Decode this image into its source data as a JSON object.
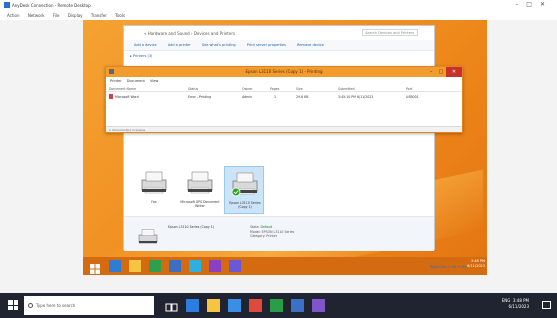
{
  "viewer": {
    "title": "AnyDesk Connection - Remote Desktop",
    "menu": [
      "Action",
      "Network",
      "File",
      "Display",
      "Transfer",
      "Tools"
    ],
    "window_controls": [
      "–",
      "□",
      "✕"
    ]
  },
  "explorer": {
    "breadcrumbs": "« Hardware and Sound › Devices and Printers",
    "search_placeholder": "Search Devices and Printers",
    "commands": [
      "Add a device",
      "Add a printer",
      "See what's printing",
      "Print server properties",
      "Remove device"
    ],
    "section_link": "▸ Printers (3)",
    "printers": [
      {
        "label": "Fax"
      },
      {
        "label": "Microsoft XPS Document Writer"
      },
      {
        "label": "Epson L3110 Series (Copy 1)"
      }
    ],
    "details": {
      "name": "Epson L3110 Series (Copy 1)",
      "state_label": "State:",
      "state_value": "Default",
      "model_label": "Model:",
      "model_value": "EPSON L3110 Series",
      "category_label": "Category:",
      "category_value": "Printer"
    }
  },
  "queue": {
    "title": "Epson L3110 Series (Copy 1) - Printing",
    "menu": [
      "Printer",
      "Document",
      "View"
    ],
    "columns": [
      "Document Name",
      "Status",
      "Owner",
      "Pages",
      "Size",
      "Submitted",
      "Port"
    ],
    "rows": [
      {
        "name": "Microsoft Word",
        "status": "Error - Printing",
        "owner": "Admin",
        "pages": "1",
        "size": "29.6 KB",
        "submitted": "3:45:10 PM 6/11/2023",
        "port": "USB001"
      }
    ],
    "status_bar": "1 document(s) in queue",
    "controls": [
      "–",
      "□",
      "✕"
    ]
  },
  "remote_tray": {
    "time": "3:48 PM",
    "date": "6/11/2023"
  },
  "bottom_note": "Right Ctrl + Alt + Del",
  "taskbar": {
    "search_placeholder": "Type here to search",
    "time": "3:48 PM",
    "date": "6/11/2023",
    "lang": "ENG"
  },
  "colors": {
    "remote_desktop": "#f08a1c",
    "queue_title": "#f29b2e",
    "host_taskbar": "#1f2430"
  }
}
